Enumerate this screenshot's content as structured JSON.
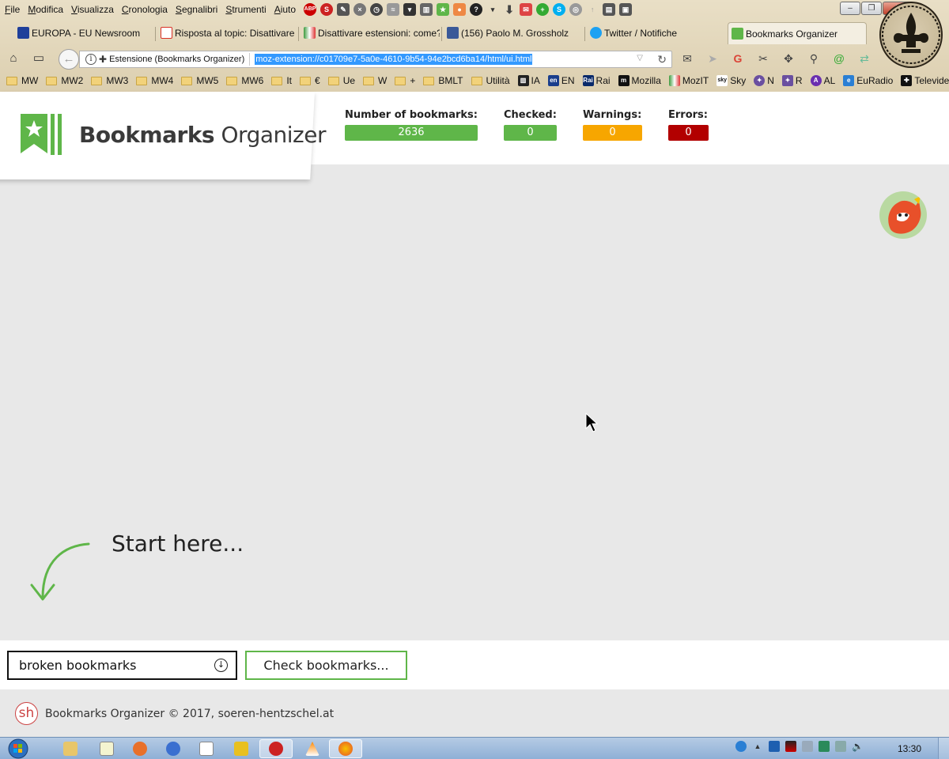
{
  "menubar": {
    "items": [
      "File",
      "Modifica",
      "Visualizza",
      "Cronologia",
      "Segnalibri",
      "Strumenti",
      "Aiuto"
    ]
  },
  "tabs": [
    {
      "label": "EUROPA - EU Newsroom",
      "favicon_color": "#1f3f9a"
    },
    {
      "label": "Risposta al topic: Disattivare",
      "favicon_color": "#d93025"
    },
    {
      "label": "Disattivare estensioni: come?",
      "favicon_color": "#3c9a3c"
    },
    {
      "label": "(156) Paolo M. Grossholz",
      "favicon_color": "#3b5998"
    },
    {
      "label": "Twitter / Notifiche",
      "favicon_color": "#1da1f2"
    },
    {
      "label": "Bookmarks Organizer",
      "favicon_color": "#5fb649"
    }
  ],
  "urlbar": {
    "identity": "Estensione (Bookmarks Organizer)",
    "url": "moz-extension://c01709e7-5a0e-4610-9b54-94e2bcd6ba14/html/ui.html"
  },
  "bookmarks_bar": [
    {
      "label": "MW",
      "type": "folder"
    },
    {
      "label": "MW2",
      "type": "folder"
    },
    {
      "label": "MW3",
      "type": "folder"
    },
    {
      "label": "MW4",
      "type": "folder"
    },
    {
      "label": "MW5",
      "type": "folder"
    },
    {
      "label": "MW6",
      "type": "folder"
    },
    {
      "label": "It",
      "type": "folder"
    },
    {
      "label": "€",
      "type": "folder"
    },
    {
      "label": "Ue",
      "type": "folder"
    },
    {
      "label": "W",
      "type": "folder"
    },
    {
      "label": "+",
      "type": "folder"
    },
    {
      "label": "BMLT",
      "type": "folder"
    },
    {
      "label": "Utilità",
      "type": "folder"
    },
    {
      "label": "IA",
      "type": "site",
      "fav": "#222"
    },
    {
      "label": "EN",
      "type": "site",
      "fav": "#1a3e8c"
    },
    {
      "label": "Rai",
      "type": "site",
      "fav": "#0a2a6a"
    },
    {
      "label": "Mozilla",
      "type": "site",
      "fav": "#111"
    },
    {
      "label": "MozIT",
      "type": "site",
      "fav": "#3c9a3c"
    },
    {
      "label": "Sky",
      "type": "site",
      "fav": "#ffffff"
    },
    {
      "label": "N",
      "type": "site",
      "fav": "#6a4fa0"
    },
    {
      "label": "R",
      "type": "site",
      "fav": "#6a4fa0"
    },
    {
      "label": "AL",
      "type": "site",
      "fav": "#6a2fb0"
    },
    {
      "label": "EuRadio",
      "type": "site",
      "fav": "#2a7fd4"
    },
    {
      "label": "Televideo",
      "type": "site",
      "fav": "#111"
    }
  ],
  "app": {
    "logo_bold": "Bookmarks",
    "logo_light": "Organizer",
    "accent": "#5fb649"
  },
  "stats": [
    {
      "label": "Number of bookmarks:",
      "value": "2636",
      "color": "#5fb649"
    },
    {
      "label": "Checked:",
      "value": "0",
      "color": "#5fb649"
    },
    {
      "label": "Warnings:",
      "value": "0",
      "color": "#f7a600"
    },
    {
      "label": "Errors:",
      "value": "0",
      "color": "#b20000"
    }
  ],
  "start_here": "Start here...",
  "mode_select": {
    "value": "broken bookmarks"
  },
  "check_button": "Check bookmarks...",
  "footer": {
    "logo": "sh",
    "text": "Bookmarks Organizer © 2017, soeren-hentzschel.at"
  },
  "taskbar": {
    "clock": "13:30"
  }
}
